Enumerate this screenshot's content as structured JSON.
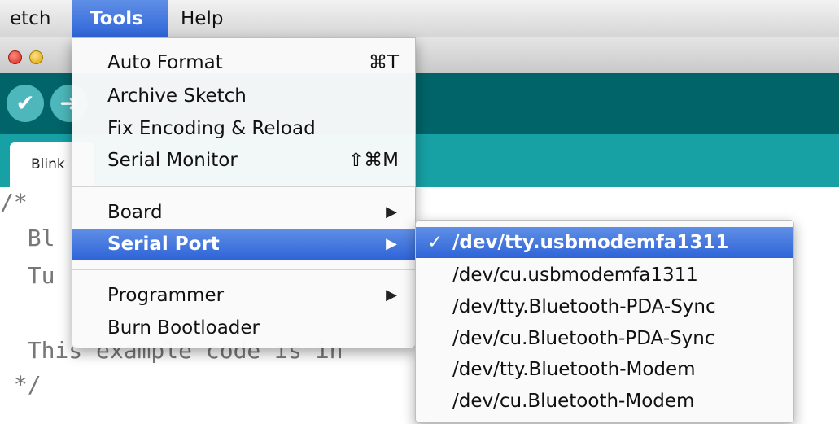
{
  "menubar": {
    "sketch": "etch",
    "tools": "Tools",
    "help": "Help"
  },
  "editor": {
    "tab_label": "Blink",
    "code_lines": [
      "/*",
      "  Bl",
      "  Tu",
      "",
      "  This example code is in",
      " */"
    ]
  },
  "tools_menu": {
    "auto_format": "Auto Format",
    "auto_format_shortcut": "⌘T",
    "archive_sketch": "Archive Sketch",
    "fix_encoding": "Fix Encoding & Reload",
    "serial_monitor": "Serial Monitor",
    "serial_monitor_shortcut": "⇧⌘M",
    "board": "Board",
    "serial_port": "Serial Port",
    "programmer": "Programmer",
    "burn_bootloader": "Burn Bootloader",
    "submenu_arrow": "▶"
  },
  "serial_port_menu": {
    "checkmark": "✓",
    "ports": [
      "/dev/tty.usbmodemfa1311",
      "/dev/cu.usbmodemfa1311",
      "/dev/tty.Bluetooth-PDA-Sync",
      "/dev/cu.Bluetooth-PDA-Sync",
      "/dev/tty.Bluetooth-Modem",
      "/dev/cu.Bluetooth-Modem"
    ],
    "selected_index": 0
  },
  "colors": {
    "highlight": "#2f64d8",
    "toolbar": "#006468",
    "tab_strip": "#17a1a5"
  }
}
